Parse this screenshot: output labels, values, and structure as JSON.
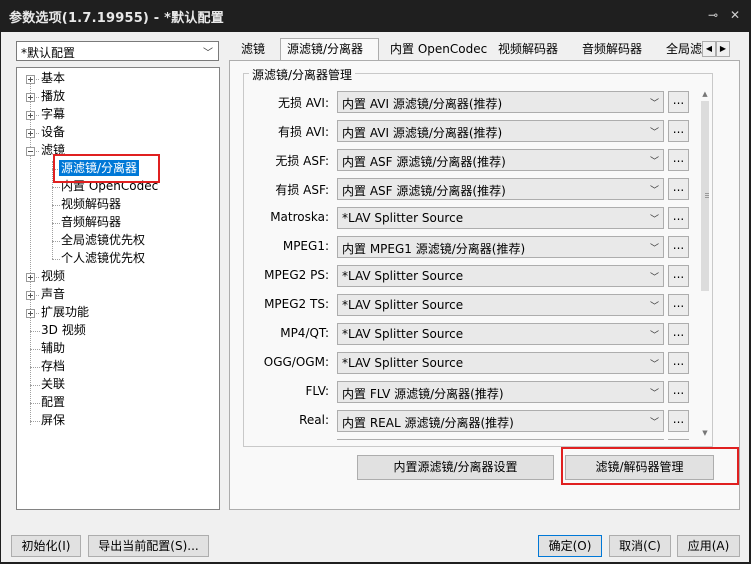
{
  "window": {
    "title": "参数选项(1.7.19955) - *默认配置",
    "pin_glyph": "⊸",
    "close_glyph": "✕"
  },
  "preset": {
    "selected": "*默认配置"
  },
  "tree": {
    "items": [
      {
        "label": "基本",
        "level": 0,
        "expander": "+"
      },
      {
        "label": "播放",
        "level": 0,
        "expander": "+"
      },
      {
        "label": "字幕",
        "level": 0,
        "expander": "+"
      },
      {
        "label": "设备",
        "level": 0,
        "expander": "+"
      },
      {
        "label": "滤镜",
        "level": 0,
        "expander": "-"
      },
      {
        "label": "源滤镜/分离器",
        "level": 1,
        "selected": true
      },
      {
        "label": "内置 OpenCodec",
        "level": 1
      },
      {
        "label": "视频解码器",
        "level": 1
      },
      {
        "label": "音频解码器",
        "level": 1
      },
      {
        "label": "全局滤镜优先权",
        "level": 1
      },
      {
        "label": "个人滤镜优先权",
        "level": 1
      },
      {
        "label": "视频",
        "level": 0,
        "expander": "+"
      },
      {
        "label": "声音",
        "level": 0,
        "expander": "+"
      },
      {
        "label": "扩展功能",
        "level": 0,
        "expander": "+"
      },
      {
        "label": "3D 视频",
        "level": 0
      },
      {
        "label": "辅助",
        "level": 0
      },
      {
        "label": "存档",
        "level": 0
      },
      {
        "label": "关联",
        "level": 0
      },
      {
        "label": "配置",
        "level": 0
      },
      {
        "label": "屏保",
        "level": 0
      }
    ]
  },
  "tabs": [
    {
      "label": "滤镜"
    },
    {
      "label": "源滤镜/分离器",
      "active": true
    },
    {
      "label": "内置 OpenCodec"
    },
    {
      "label": "视频解码器"
    },
    {
      "label": "音频解码器"
    },
    {
      "label": "全局滤"
    }
  ],
  "group": {
    "title": "源滤镜/分离器管理",
    "rows": [
      {
        "label": "无损 AVI:",
        "value": "内置 AVI 源滤镜/分离器(推荐)"
      },
      {
        "label": "有损 AVI:",
        "value": "内置 AVI 源滤镜/分离器(推荐)"
      },
      {
        "label": "无损 ASF:",
        "value": "内置 ASF 源滤镜/分离器(推荐)"
      },
      {
        "label": "有损 ASF:",
        "value": "内置 ASF 源滤镜/分离器(推荐)"
      },
      {
        "label": "Matroska:",
        "value": "*LAV Splitter Source"
      },
      {
        "label": "MPEG1:",
        "value": "内置 MPEG1 源滤镜/分离器(推荐)"
      },
      {
        "label": "MPEG2 PS:",
        "value": "*LAV Splitter Source"
      },
      {
        "label": "MPEG2 TS:",
        "value": "*LAV Splitter Source"
      },
      {
        "label": "MP4/QT:",
        "value": "*LAV Splitter Source"
      },
      {
        "label": "OGG/OGM:",
        "value": "*LAV Splitter Source"
      },
      {
        "label": "FLV:",
        "value": "内置 FLV 源滤镜/分离器(推荐)"
      },
      {
        "label": "Real:",
        "value": "内置 REAL 源滤镜/分离器(推荐)"
      },
      {
        "label": "",
        "value": ""
      }
    ],
    "more_label": "..."
  },
  "panel_buttons": {
    "builtin_settings": "内置源滤镜/分离器设置",
    "filter_decoder_manage": "滤镜/解码器管理"
  },
  "footer": {
    "init": "初始化(I)",
    "export": "导出当前配置(S)...",
    "ok": "确定(O)",
    "cancel": "取消(C)",
    "apply": "应用(A)"
  }
}
